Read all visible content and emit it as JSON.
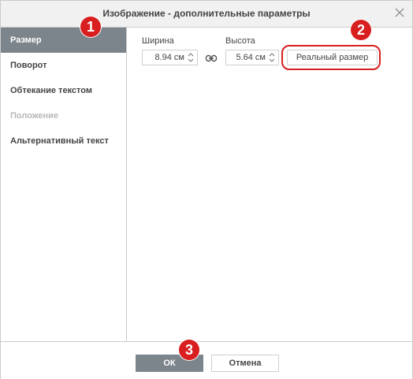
{
  "dialog": {
    "title": "Изображение - дополнительные параметры"
  },
  "sidebar": {
    "items": [
      {
        "label": "Размер",
        "state": "active"
      },
      {
        "label": "Поворот",
        "state": "normal"
      },
      {
        "label": "Обтекание текстом",
        "state": "normal"
      },
      {
        "label": "Положение",
        "state": "disabled"
      },
      {
        "label": "Альтернативный текст",
        "state": "normal"
      }
    ]
  },
  "size": {
    "width_label": "Ширина",
    "width_value": "8.94 см",
    "height_label": "Высота",
    "height_value": "5.64 см",
    "real_size_button": "Реальный размер"
  },
  "footer": {
    "ok_label": "ОК",
    "cancel_label": "Отмена"
  },
  "annotations": {
    "badge1": "1",
    "badge2": "2",
    "badge3": "3"
  },
  "colors": {
    "accent": "#7d858c",
    "annotation_red": "#d81e1e",
    "border": "#cbcbcb"
  },
  "icons": [
    "close-icon",
    "link-icon",
    "spinner-arrows-icon"
  ]
}
